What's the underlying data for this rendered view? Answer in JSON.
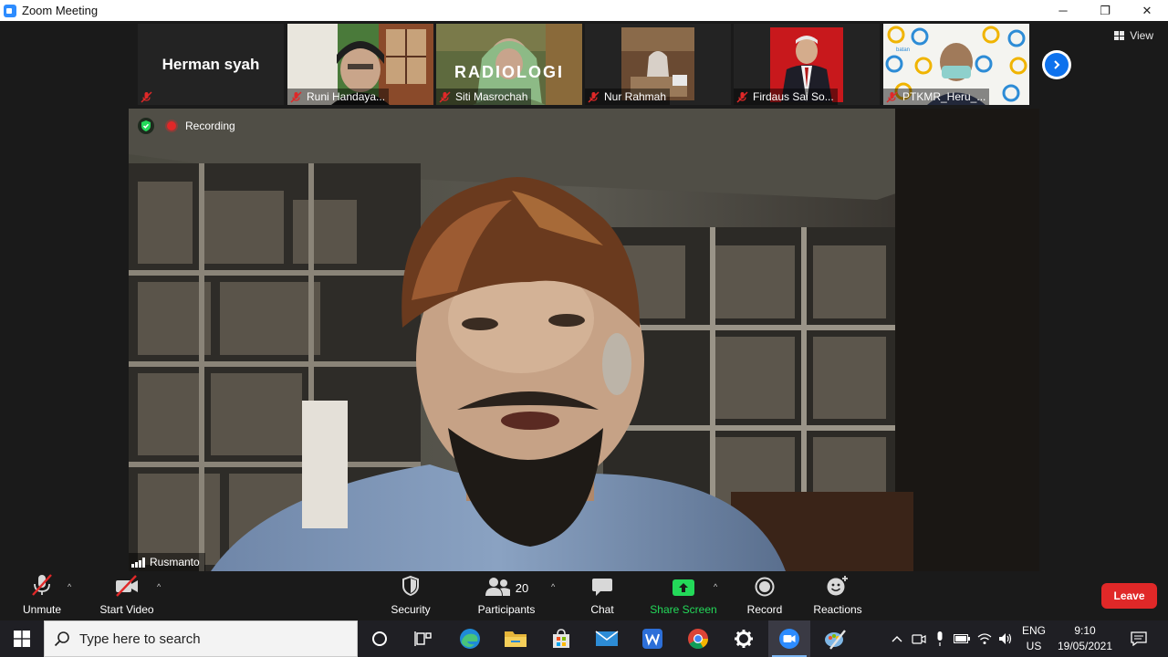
{
  "window": {
    "title": "Zoom Meeting",
    "controls": {
      "minimize": "─",
      "maximize": "❐",
      "close": "✕"
    }
  },
  "thumbnails": [
    {
      "name": "Herman syah",
      "muted": true,
      "video": false
    },
    {
      "name": "Runi Handaya...",
      "muted": true,
      "video": true
    },
    {
      "name": "Siti Masrochah",
      "muted": true,
      "video": true,
      "background_text": "RADIOLOGI"
    },
    {
      "name": "Nur Rahmah",
      "muted": true,
      "video": true
    },
    {
      "name": "Firdaus Sai So...",
      "muted": true,
      "video": true
    },
    {
      "name": "PTKMR_Heru_...",
      "muted": true,
      "video": true,
      "background_text": "batan"
    }
  ],
  "view_button": {
    "label": "View"
  },
  "main_video": {
    "speaker": "Rusmanto",
    "recording_label": "Recording"
  },
  "toolbar": {
    "unmute": "Unmute",
    "start_video": "Start Video",
    "security": "Security",
    "participants": "Participants",
    "participants_count": "20",
    "chat": "Chat",
    "share_screen": "Share Screen",
    "record": "Record",
    "reactions": "Reactions",
    "leave": "Leave"
  },
  "taskbar": {
    "search_placeholder": "Type here to search",
    "language_line1": "ENG",
    "language_line2": "US",
    "time": "9:10",
    "date": "19/05/2021"
  },
  "colors": {
    "leave": "#e02828",
    "share_screen": "#23d959",
    "accent_blue": "#0e72ed",
    "muted_red": "#e02828"
  }
}
